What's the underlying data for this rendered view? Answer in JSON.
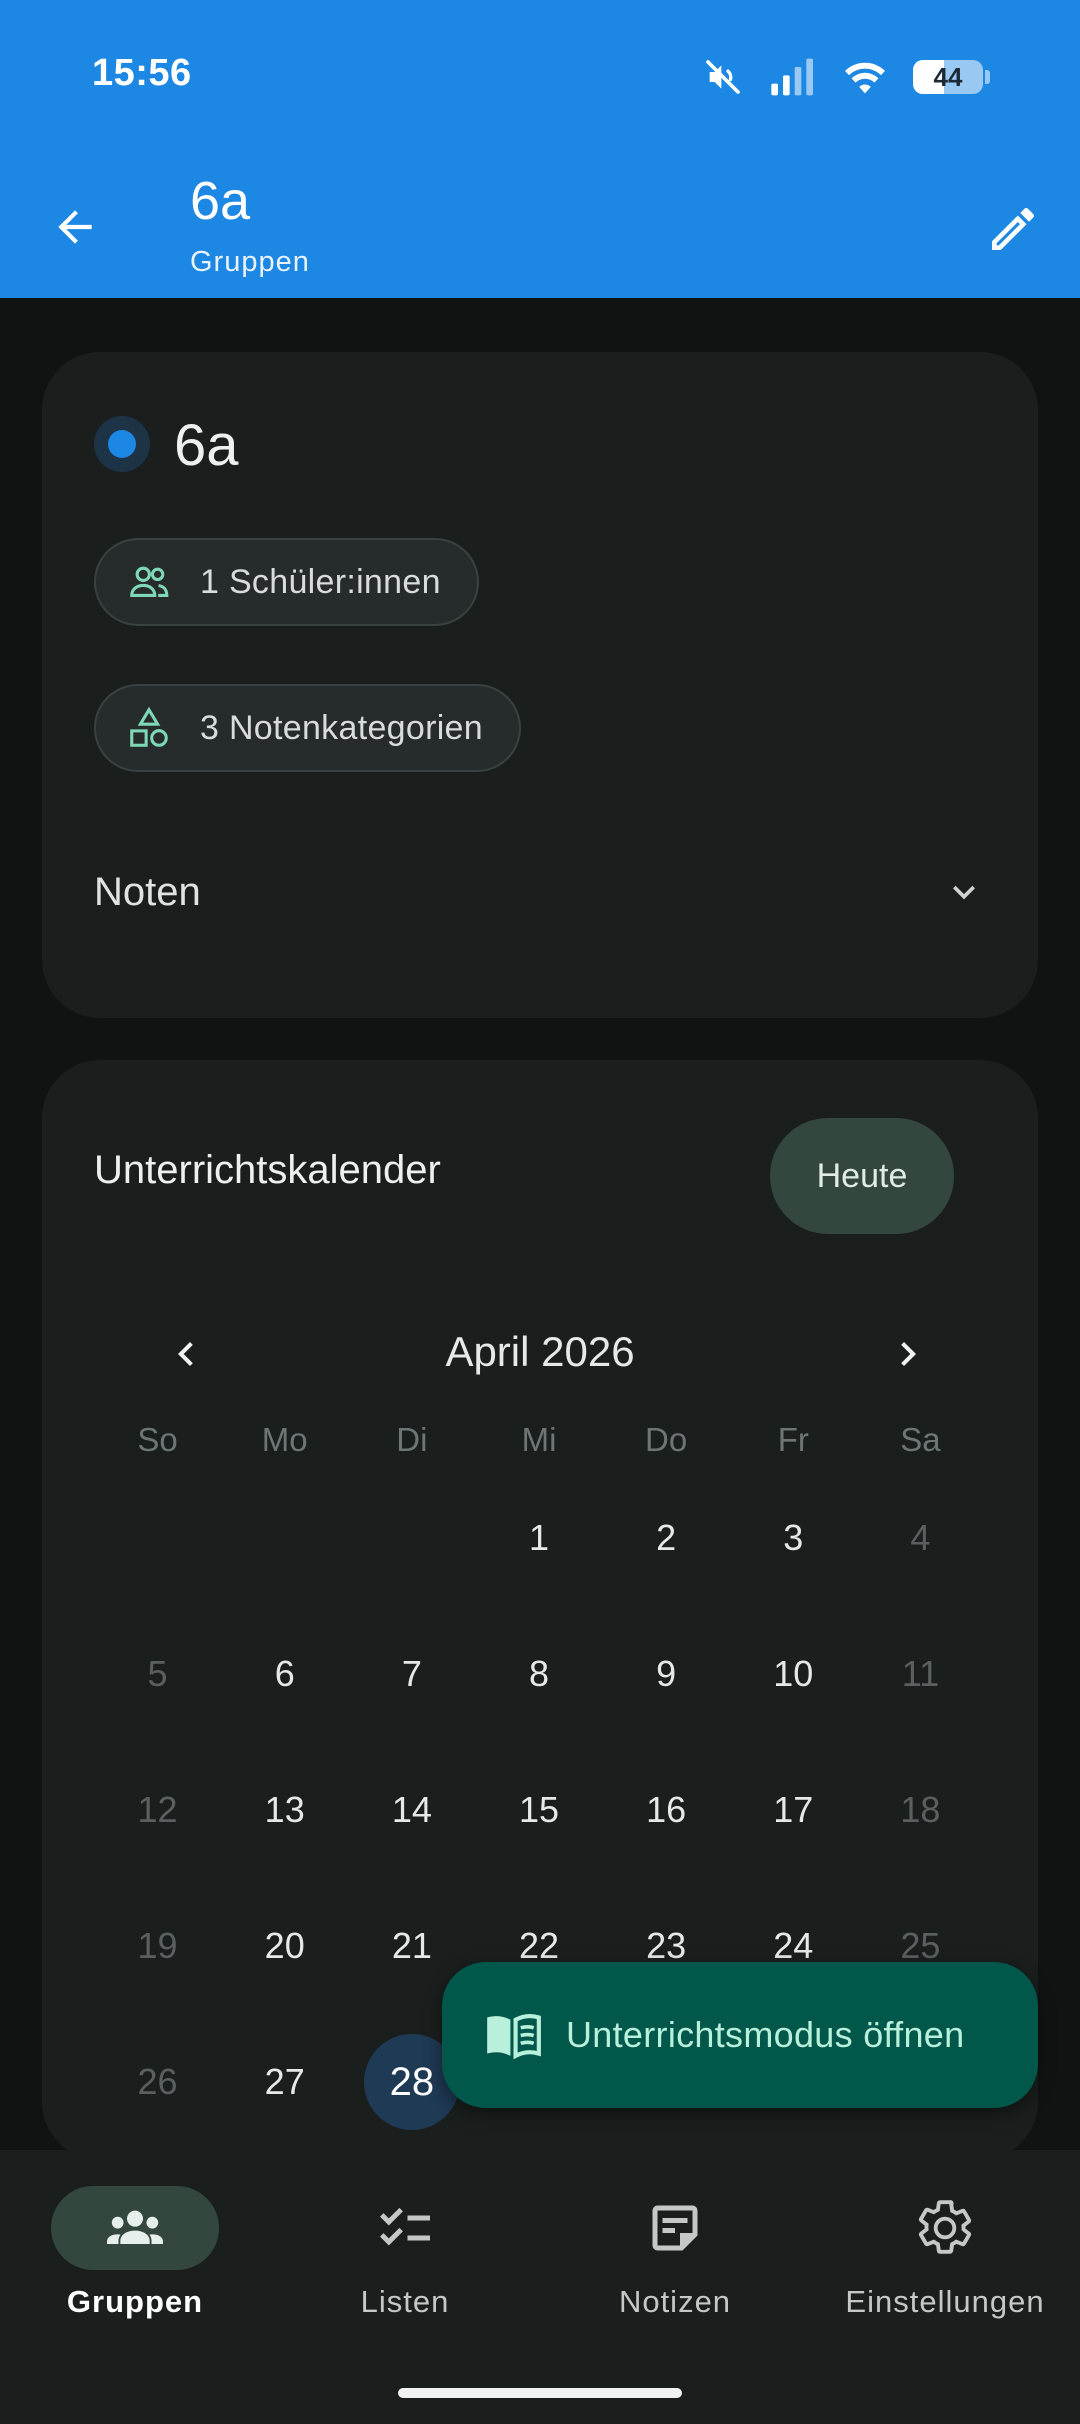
{
  "status_bar": {
    "time": "15:56",
    "battery_level": "44",
    "icons": [
      "mute-icon",
      "signal-icon",
      "wifi-icon",
      "battery-icon"
    ]
  },
  "app_bar": {
    "title": "6a",
    "subtitle": "Gruppen",
    "color": "#1d87e4"
  },
  "group_card": {
    "name": "6a",
    "accent_color": "#1d87e4",
    "students_chip": "1 Schüler:innen",
    "categories_chip": "3 Notenkategorien",
    "grades_label": "Noten"
  },
  "calendar": {
    "title": "Unterrichtskalender",
    "today_button": "Heute",
    "month_label": "April 2026",
    "weekdays": [
      "So",
      "Mo",
      "Di",
      "Mi",
      "Do",
      "Fr",
      "Sa"
    ],
    "leading_blanks": 3,
    "days_in_month": 30,
    "selected_day": 28
  },
  "fab": {
    "label": "Unterrichtsmodus öffnen",
    "icon": "book-open-icon"
  },
  "bottom_nav": {
    "items": [
      {
        "label": "Gruppen",
        "icon": "groups-icon",
        "active": true
      },
      {
        "label": "Listen",
        "icon": "checklist-icon",
        "active": false
      },
      {
        "label": "Notizen",
        "icon": "note-icon",
        "active": false
      },
      {
        "label": "Einstellungen",
        "icon": "gear-icon",
        "active": false
      }
    ]
  }
}
